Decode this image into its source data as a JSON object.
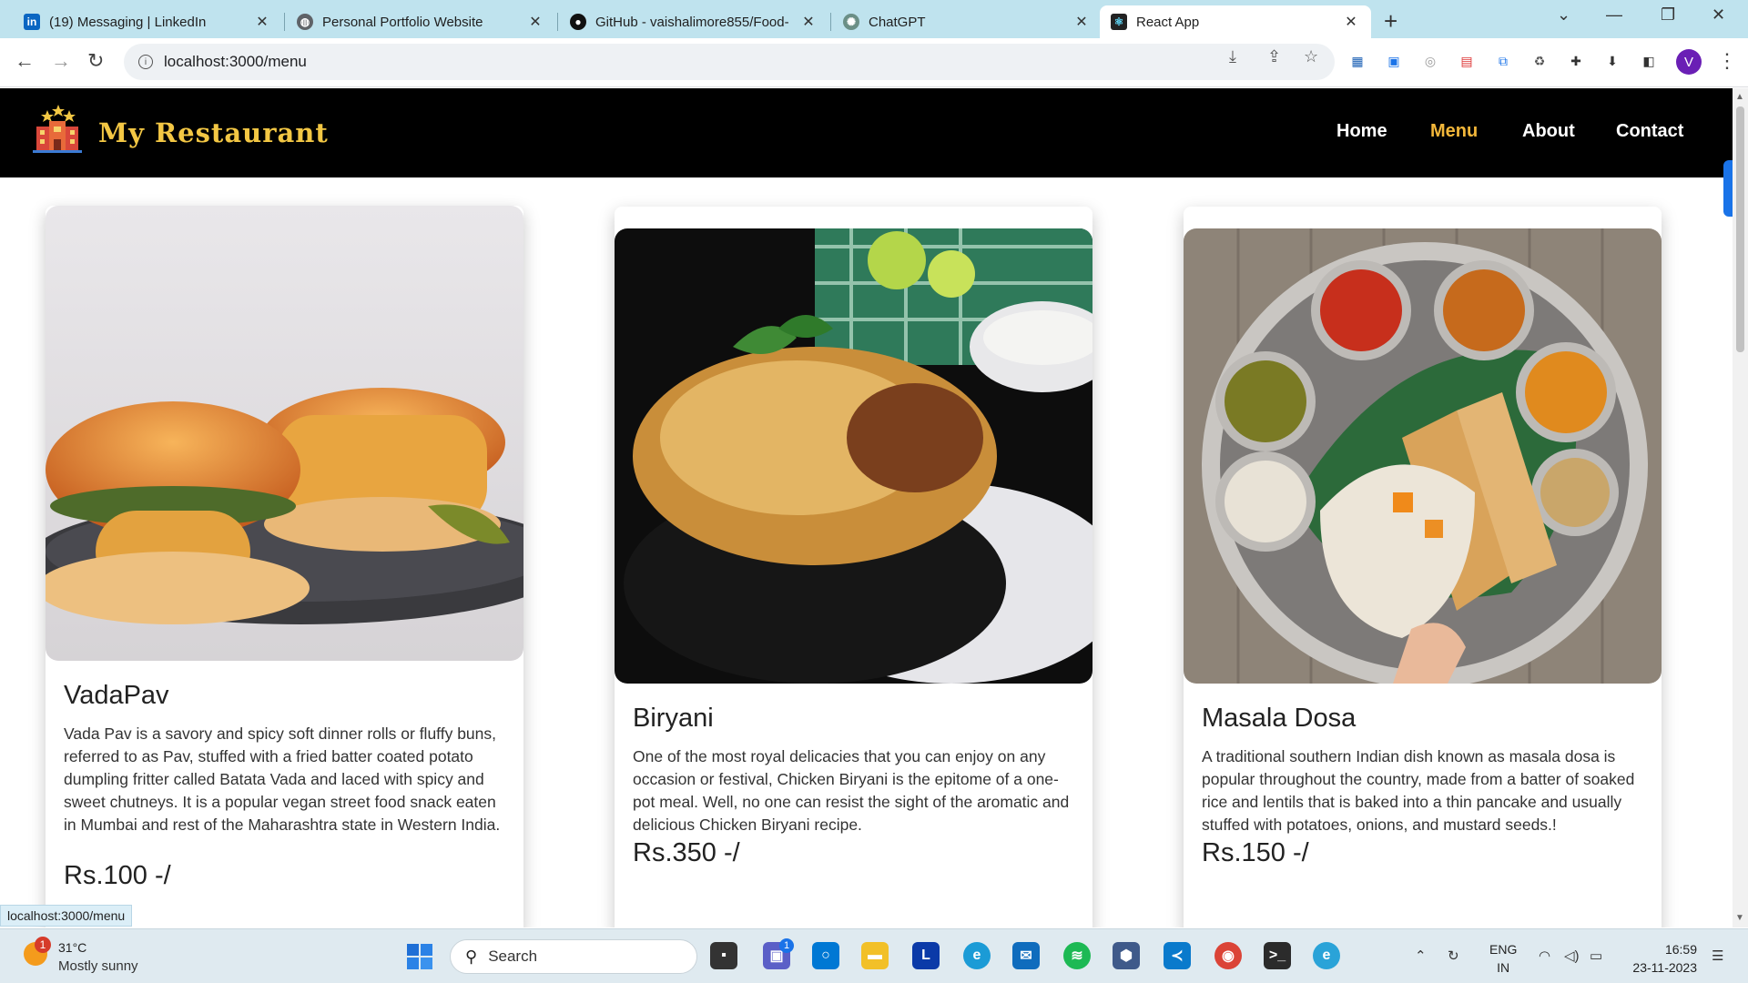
{
  "browser": {
    "tabs": [
      {
        "title": "(19) Messaging | LinkedIn",
        "icon": "linkedin-icon",
        "color": "#0a66c2"
      },
      {
        "title": "Personal Portfolio Website",
        "icon": "globe-icon",
        "color": "#5f6368"
      },
      {
        "title": "GitHub - vaishalimore855/Food-",
        "icon": "github-icon",
        "color": "#111111"
      },
      {
        "title": "ChatGPT",
        "icon": "chatgpt-icon",
        "color": "#6b8f86"
      },
      {
        "title": "React App",
        "icon": "react-icon",
        "color": "#222222"
      }
    ],
    "active_tab": 4,
    "url": "localhost:3000/menu",
    "profile_initial": "V"
  },
  "site": {
    "brand": "My Restaurant",
    "nav": [
      {
        "label": "Home",
        "active": false
      },
      {
        "label": "Menu",
        "active": true
      },
      {
        "label": "About",
        "active": false
      },
      {
        "label": "Contact",
        "active": false
      }
    ],
    "accent_color": "#f3b73a"
  },
  "menu_items": [
    {
      "name": "VadaPav",
      "description": "Vada Pav is a savory and spicy soft dinner rolls or fluffy buns, referred to as Pav, stuffed with a fried batter coated potato dumpling fritter called Batata Vada and laced with spicy and sweet chutneys. It is a popular vegan street food snack eaten in Mumbai and rest of the Maharashtra state in Western India.",
      "price": "Rs.100 -/"
    },
    {
      "name": "Biryani",
      "description": "One of the most royal delicacies that you can enjoy on any occasion or festival, Chicken Biryani is the epitome of a one-pot meal. Well, no one can resist the sight of the aromatic and delicious Chicken Biryani recipe.",
      "price": "Rs.350 -/"
    },
    {
      "name": "Masala Dosa",
      "description": "A traditional southern Indian dish known as masala dosa is popular throughout the country, made from a batter of soaked rice and lentils that is baked into a thin pancake and usually stuffed with potatoes, onions, and mustard seeds.!",
      "price": "Rs.150 -/"
    }
  ],
  "status_url": "localhost:3000/menu",
  "taskbar": {
    "weather_temp": "31°C",
    "weather_condition": "Mostly sunny",
    "weather_badge": "1",
    "search_label": "Search",
    "lang_top": "ENG",
    "lang_bottom": "IN",
    "time": "16:59",
    "date": "23-11-2023",
    "chat_badge": "1"
  }
}
